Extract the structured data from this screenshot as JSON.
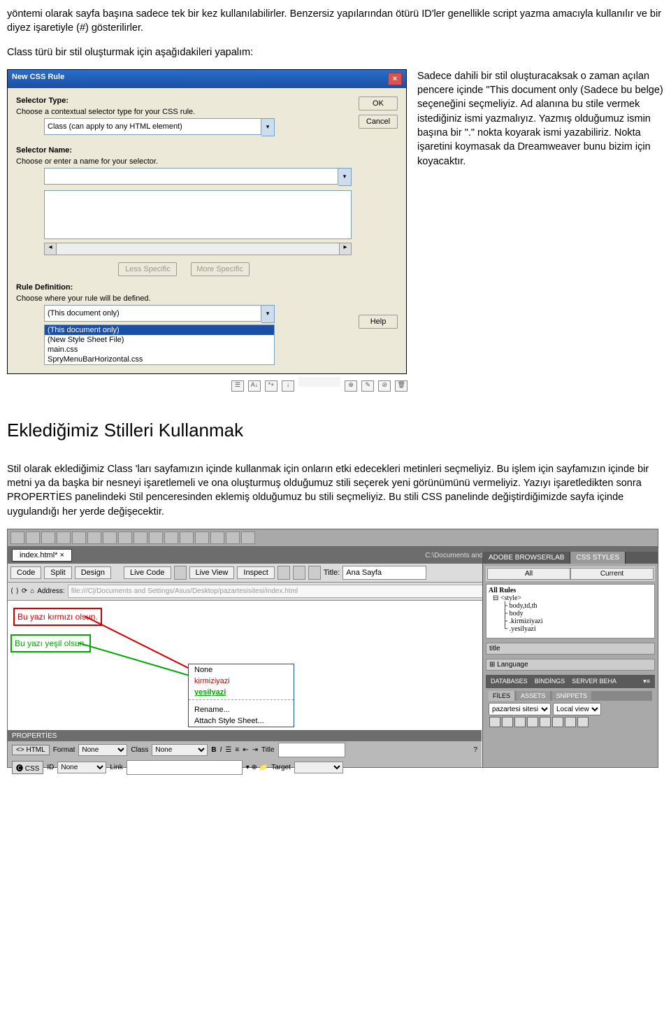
{
  "para1": "yöntemi olarak sayfa başına sadece tek bir kez kullanılabilirler. Benzersiz yapılarından ötürü ID'ler genellikle script yazma amacıyla kullanılır ve bir diyez işaretiyle (#) gösterilirler.",
  "para2": "Class türü bir stil oluşturmak için aşağıdakileri yapalım:",
  "dialog": {
    "title": "New CSS Rule",
    "selector_type": "Selector Type:",
    "selector_type_desc": "Choose a contextual selector type for your CSS rule.",
    "selector_type_value": "Class (can apply to any HTML element)",
    "selector_name": "Selector Name:",
    "selector_name_desc": "Choose or enter a name for your selector.",
    "less": "Less Specific",
    "more": "More Specific",
    "rule_def": "Rule Definition:",
    "rule_def_desc": "Choose where your rule will be defined.",
    "opt1": "(This document only)",
    "opt2": "(This document only)",
    "opt3": "(New Style Sheet File)",
    "opt4": "main.css",
    "opt5": "SpryMenuBarHorizontal.css",
    "ok": "OK",
    "cancel": "Cancel",
    "help": "Help"
  },
  "side1": "Sadece dahili bir stil oluşturacaksak o zaman açılan pencere içinde \"This document only (Sadece bu belge) seçeneğini seçmeliyiz. Ad alanına bu stile vermek istediğiniz ismi yazmalıyız. Yazmış olduğumuz ismin başına bir \".\" nokta koyarak ismi yazabiliriz. Nokta işaretini koymasak da Dreamweaver bunu bizim için koyacaktır.",
  "h2": "Eklediğimiz Stilleri Kullanmak",
  "para3": "Stil olarak eklediğimiz Class 'ları sayfamızın içinde kullanmak için onların etki edecekleri metinleri seçmeliyiz. Bu işlem için sayfamızın içinde bir metni ya da başka bir nesneyi işaretlemeli ve ona oluşturmuş olduğumuz stili seçerek yeni görünümünü vermeliyiz. Yazıyı işaretledikten sonra PROPERTİES  panelindeki Stil penceresinden eklemiş olduğumuz bu stili seçmeliyiz. Bu stili CSS panelinde değiştirdiğimizde sayfa içinde uygulandığı her yerde değişecektir.",
  "dw": {
    "tab": "index.html* ×",
    "path": "C:\\Documents and Settings\\Asus\\Desktop\\pazartesisitesi\\index.html",
    "code": "Code",
    "split": "Split",
    "design": "Design",
    "livecode": "Live Code",
    "liveview": "Live View",
    "inspect": "Inspect",
    "titlelbl": "Title:",
    "titleval": "Ana Sayfa",
    "addrlbl": "Address:",
    "addrval": "file:///C|/Documents and Settings/Asus/Desktop/pazartesisitesi/index.html",
    "redtext": "Bu yazı kırmızı olsun.",
    "greentext": "Bu yazı yeşil olsun.",
    "pop_none": "None",
    "pop_k": "kirmiziyazi",
    "pop_y": "yesilyazi",
    "pop_ren": "Rename...",
    "pop_att": "Attach Style Sheet...",
    "cssstyles": "CSS STYLES",
    "browserlab": "ADOBE BROWSERLAB",
    "all": "All",
    "current": "Current",
    "allrules": "All Rules",
    "r_style": "<style>",
    "r1": "body,td,th",
    "r2": "body",
    "r3": ".kirmiziyazi",
    "r4": ".yesilyazi",
    "p_title": "title",
    "p_lang": "Language",
    "db": "DATABASES",
    "bind": "BİNDİNGS",
    "srv": "SERVER BEHA",
    "files": "FİLES",
    "assets": "ASSETS",
    "snip": "SNİPPETS",
    "site": "pazartesi sitesi",
    "view": "Local view",
    "props": "PROPERTİES",
    "html": "HTML",
    "css": "CSS",
    "format": "Format",
    "none": "None",
    "class": "Class",
    "id": "ID",
    "link": "Link",
    "ptitle": "Title",
    "target": "Target"
  }
}
